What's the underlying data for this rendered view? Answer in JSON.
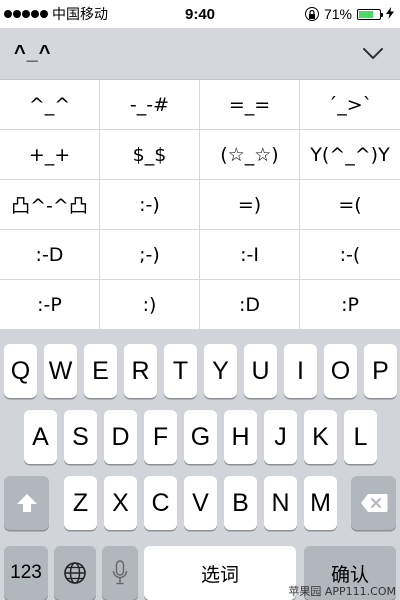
{
  "status_bar": {
    "signal_bars": 5,
    "carrier": "中国移动",
    "time": "9:40",
    "battery_percent": "71%",
    "battery_level": 0.71,
    "lock_icon": "orientation-lock-icon",
    "charge_icon": "charging-bolt-icon"
  },
  "emoticon_panel": {
    "header_label": "^_^",
    "collapse_icon": "chevron-down-icon",
    "items": [
      "^_^",
      "-_-#",
      "=_=",
      "´_>`",
      "+_+",
      "$_$",
      "(☆_☆)",
      "Y(^_^)Y",
      "凸^-^凸",
      ":-)",
      "=)",
      "=(",
      ":-D",
      ";-)",
      ":-I",
      ":-(",
      ":-P",
      ":)",
      ":D",
      ":P"
    ]
  },
  "keyboard": {
    "row1": [
      "Q",
      "W",
      "E",
      "R",
      "T",
      "Y",
      "U",
      "I",
      "O",
      "P"
    ],
    "row2": [
      "A",
      "S",
      "D",
      "F",
      "G",
      "H",
      "J",
      "K",
      "L"
    ],
    "row3": [
      "Z",
      "X",
      "C",
      "V",
      "B",
      "N",
      "M"
    ],
    "numbers_label": "123",
    "space_label": "选词",
    "return_label": "确认",
    "icons": {
      "shift": "shift-arrow-icon",
      "delete": "delete-backspace-icon",
      "globe": "globe-icon",
      "mic": "microphone-icon"
    }
  },
  "watermark": "苹果园 APP111.COM",
  "colors": {
    "keyboard_bg": "#d1d4d9",
    "key_bg": "#ffffff",
    "func_key_bg": "#b2b6bd",
    "header_bg": "#d5d7dc",
    "battery_fill": "#4cd964"
  }
}
